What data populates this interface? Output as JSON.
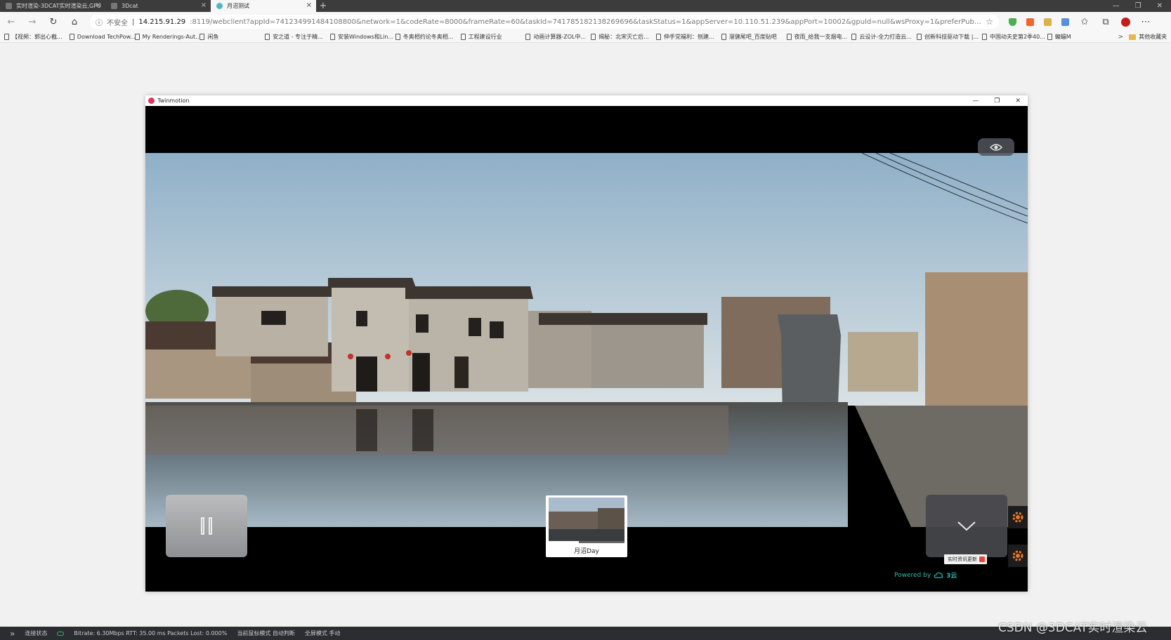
{
  "browser": {
    "tabs": [
      {
        "title": "实时渲染-3DCAT实时渲染云,GPU"
      },
      {
        "title": "3Dcat"
      },
      {
        "title": "月沼测试"
      }
    ],
    "new_tab": "+",
    "window_controls": [
      "—",
      "❐",
      "✕"
    ],
    "url": {
      "insecure_label": "不安全",
      "host": "14.215.91.29",
      "rest": ":8119/webclient?appId=741234991484108800&network=1&codeRate=8000&frameRate=60&taskId=741785182138269696&taskStatus=1&appServer=10.110.51.239&appPort=10002&gpuId=null&wsProxy=1&preferPubOutIp=14.215.91.29&init..."
    },
    "bookmarks": [
      "【视频：郭出心截...",
      "Download TechPow...",
      "My Renderings-Aut...",
      "闲鱼",
      "安之道 - 专注于精...",
      "安装Windows和Lin...",
      "冬奥相约论冬奥相...",
      "工程建设行业",
      "动画计算器-ZOL中...",
      "揭秘：北宋灭亡后...",
      "伸手党福利：刨建...",
      "溜健尾吧_百度贴吧",
      "夜雨_给我一支烟电...",
      "云设计-全力打造云...",
      "创新科技驱动下载 |...",
      "中国动夫史第2季40...",
      "蝙蝠M"
    ],
    "bookmarks_more": ">",
    "bookmarks_folder": "其他收藏夹"
  },
  "app": {
    "title": "Twinmotion",
    "window_controls": [
      "—",
      "❐",
      "✕"
    ],
    "scene_label": "月沼Day",
    "scene_progress": 0.4,
    "news_badge": "实时资讯更新",
    "powered_by": "Powered by",
    "brand": "3云"
  },
  "status": {
    "connection": "连接状态",
    "stats": "Bitrate: 6.30Mbps RTT: 35.00 ms Packets Lost: 0.000%",
    "mouse_mode": "当前鼠标模式 自动判断",
    "fullscreen": "全屏模式 手动"
  },
  "watermark": "CSDN @3DCAT实时渲染云",
  "colors": {
    "accent_teal": "#2fb9b2",
    "gear_orange": "#e8772e",
    "profile_red": "#c3201d"
  }
}
